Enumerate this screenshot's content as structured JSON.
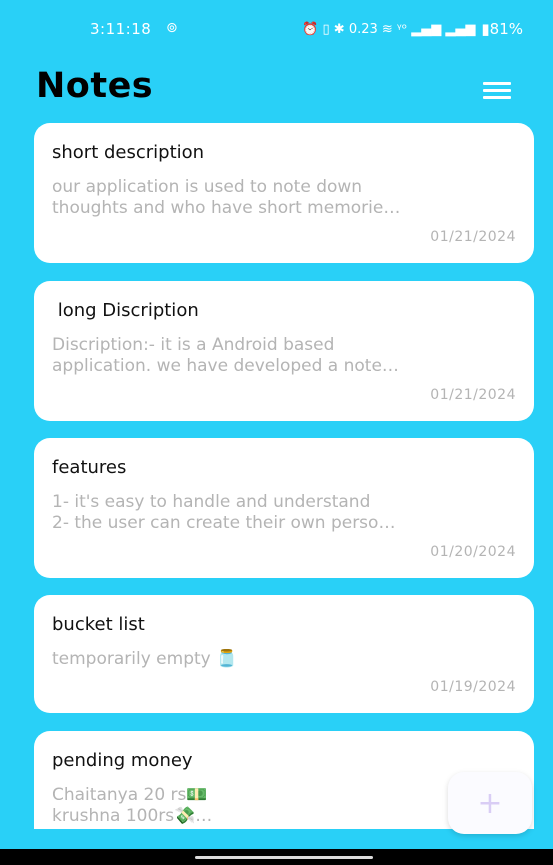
{
  "status_bar": {
    "time": "3:11:18",
    "time_icon": "⊚",
    "icons": "⏰ ▯ ✱ 0.23 ≋ ᵞᵒ ▂▄▆ ▂▄▆",
    "battery": "▮81%"
  },
  "header": {
    "title": "Notes",
    "menu_icon": "hamburger-menu-icon"
  },
  "notes": [
    {
      "title": "short description",
      "lines": [
        "our application is used to note down",
        "thoughts and who have short memorie…"
      ],
      "date": "01/21/2024"
    },
    {
      "title": " long Discription",
      "lines": [
        "Discription:- it is a Android based",
        "application. we have developed a note…"
      ],
      "date": "01/21/2024"
    },
    {
      "title": "features",
      "lines": [
        "1- it's easy to handle and understand",
        "2- the user can create their own perso…"
      ],
      "date": "01/20/2024"
    },
    {
      "title": "bucket list",
      "lines": [
        "temporarily empty 🫙"
      ],
      "date": "01/19/2024"
    },
    {
      "title": "pending money",
      "lines": [
        "Chaitanya 20 rs💵",
        "krushna 100rs💸…"
      ],
      "date": ""
    }
  ],
  "fab": {
    "label": "+",
    "icon": "plus-icon"
  },
  "colors": {
    "background": "#29d0f7",
    "card": "#ffffff",
    "muted_text": "#b4b4b4",
    "fab_icon": "#d9cdf5"
  }
}
